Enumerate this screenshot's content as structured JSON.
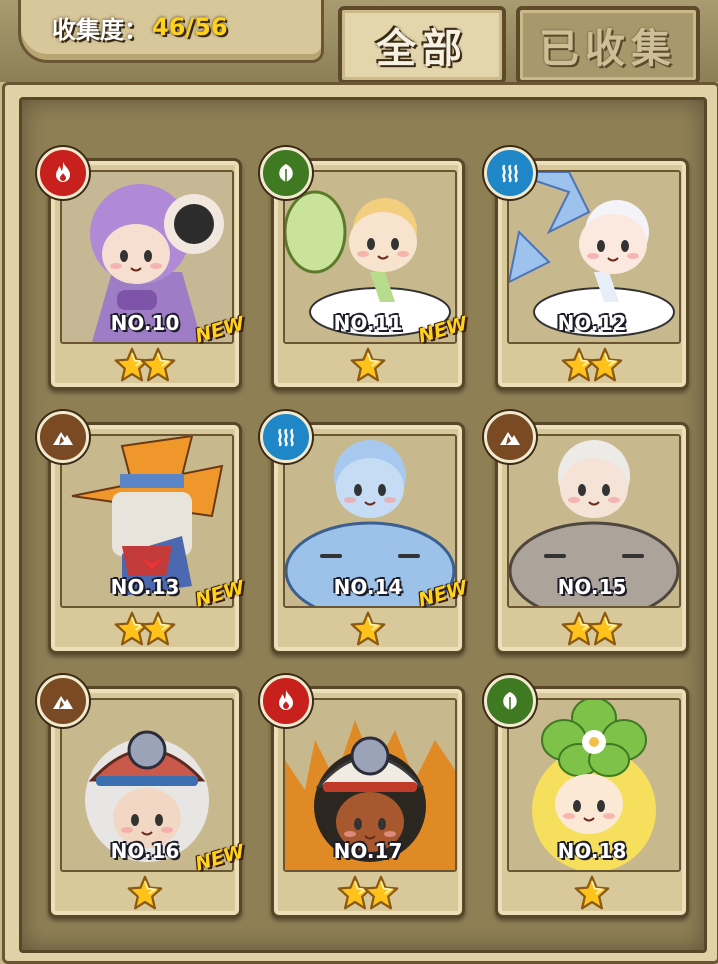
{
  "header": {
    "collect_label": "收集度：",
    "collect_value": "46/56",
    "tab_all": "全部",
    "tab_collected": "已收集"
  },
  "cards": [
    {
      "no": "NO.10",
      "element": "fire",
      "stars": 2,
      "new": "NEW",
      "figure": "purple-moth-girl"
    },
    {
      "no": "NO.11",
      "element": "leaf",
      "stars": 1,
      "new": "NEW",
      "figure": "leaf-fairy-on-cloud"
    },
    {
      "no": "NO.12",
      "element": "water",
      "stars": 2,
      "new": "",
      "figure": "ice-fairy-on-cloud"
    },
    {
      "no": "NO.13",
      "element": "earth",
      "stars": 2,
      "new": "NEW",
      "figure": "scarecrow-witch"
    },
    {
      "no": "NO.14",
      "element": "water",
      "stars": 1,
      "new": "NEW",
      "figure": "blue-slime-girl"
    },
    {
      "no": "NO.15",
      "element": "earth",
      "stars": 2,
      "new": "",
      "figure": "grey-rock-girl"
    },
    {
      "no": "NO.16",
      "element": "earth",
      "stars": 1,
      "new": "NEW",
      "figure": "miner-girl-white"
    },
    {
      "no": "NO.17",
      "element": "fire",
      "stars": 2,
      "new": "",
      "figure": "miner-girl-dark"
    },
    {
      "no": "NO.18",
      "element": "leaf",
      "stars": 1,
      "new": "",
      "figure": "flower-girl"
    }
  ],
  "colors": {
    "fire": "#c8201c",
    "leaf": "#3f7a22",
    "water": "#1f86c8",
    "earth": "#7a4a24",
    "star": "#ffc21a",
    "new_badge": "#ffd21e"
  }
}
